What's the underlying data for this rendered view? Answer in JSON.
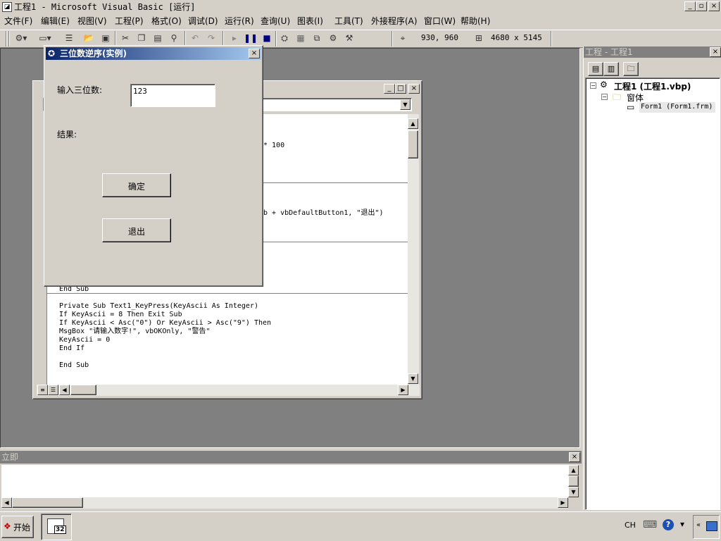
{
  "window": {
    "title": "工程1 - Microsoft Visual Basic [运行]",
    "min": "_",
    "max": "▫",
    "close": "×"
  },
  "menu": [
    "文件(F)",
    "编辑(E)",
    "视图(V)",
    "工程(P)",
    "格式(O)",
    "调试(D)",
    "运行(R)",
    "查询(U)",
    "图表(I)",
    "工具(T)",
    "外接程序(A)",
    "窗口(W)",
    "帮助(H)"
  ],
  "toolbar": {
    "position": "930, 960",
    "size": "4680 x 5145"
  },
  "project": {
    "title": "工程 - 工程1",
    "root": "工程1 (工程1.vbp)",
    "folder": "窗体",
    "form": "Form1 (Form1.frm)"
  },
  "form": {
    "title": "三位数逆序(实例)",
    "input_label": "输入三位数:",
    "input_value": "123",
    "result_label": "结果:",
    "ok_button": "确定",
    "exit_button": "退出"
  },
  "code": {
    "frag1": "* 100",
    "frag2": "b + vbDefaultButton1, \"退出\")",
    "lines": [
      "End Sub",
      "Private Sub Text1_KeyPress(KeyAscii As Integer)",
      "If KeyAscii = 8 Then Exit Sub",
      "If KeyAscii < Asc(\"0\") Or KeyAscii > Asc(\"9\") Then",
      "MsgBox \"请输入数字!\", vbOKOnly, \"警告\"",
      "KeyAscii = 0",
      "End If",
      "End Sub"
    ]
  },
  "immediate": {
    "title": "立即"
  },
  "taskbar": {
    "start": "开始",
    "ime": "CH",
    "app_badge": "32"
  }
}
